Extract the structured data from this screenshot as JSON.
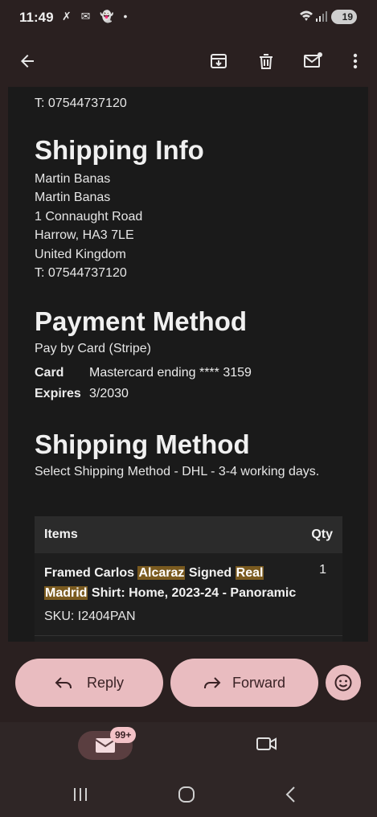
{
  "status": {
    "time": "11:49",
    "notification_icons": "✗ ✉ 👻 •",
    "battery": "19"
  },
  "appbar": {
    "back": "back-arrow-icon",
    "archive": "archive-icon",
    "delete": "trash-icon",
    "mark_unread": "mail-unread-icon",
    "more": "more-vert-icon"
  },
  "email": {
    "billing_phone": "T: 07544737120",
    "shipping_info": {
      "title": "Shipping Info",
      "lines": [
        "Martin Banas",
        "Martin Banas",
        "1 Connaught Road",
        "Harrow, HA3 7LE",
        "United Kingdom",
        "T: 07544737120"
      ]
    },
    "payment": {
      "title": "Payment Method",
      "method": "Pay by Card (Stripe)",
      "card_label": "Card",
      "card_value": "Mastercard ending **** 3159",
      "expires_label": "Expires",
      "expires_value": "3/2030"
    },
    "shipping_method": {
      "title": "Shipping Method",
      "text": "Select Shipping Method - DHL - 3-4 working days."
    },
    "items_table": {
      "col_items": "Items",
      "col_qty": "Qty",
      "rows": [
        {
          "name_parts": [
            "Framed Carlos ",
            "Alcaraz",
            " Signed ",
            "Real",
            " ",
            "Madrid",
            " Shirt: Home, 2023-24 - Panoramic"
          ],
          "qty": "1",
          "sku": "SKU: I2404PAN"
        }
      ]
    }
  },
  "actions": {
    "reply": "Reply",
    "forward": "Forward"
  },
  "bottom_nav": {
    "mail_badge": "99+"
  }
}
